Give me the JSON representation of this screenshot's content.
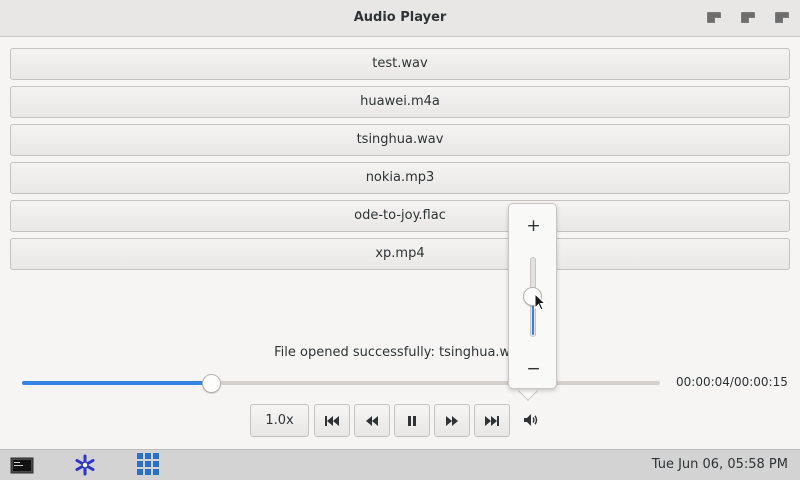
{
  "window": {
    "title": "Audio Player",
    "controls": [
      "minimize-icon",
      "maximize-icon",
      "close-icon"
    ]
  },
  "playlist": [
    {
      "name": "test.wav"
    },
    {
      "name": "huawei.m4a"
    },
    {
      "name": "tsinghua.wav"
    },
    {
      "name": "nokia.mp3"
    },
    {
      "name": "ode-to-joy.flac"
    },
    {
      "name": "xp.mp4"
    }
  ],
  "status_text": "File opened successfully: tsinghua.wav",
  "seek": {
    "progress_fraction": 0.296,
    "time": "00:00:04/00:00:15"
  },
  "controls": {
    "speed_label": "1.0x",
    "buttons": [
      "skip-previous-icon",
      "rewind-icon",
      "pause-icon",
      "fast-forward-icon",
      "skip-next-icon"
    ],
    "volume_icon": "volume-icon"
  },
  "volume_popover": {
    "plus": "+",
    "minus": "−",
    "level_fraction": 0.5
  },
  "taskbar": {
    "icons": [
      "terminal-icon",
      "asterisk-app-icon",
      "app-grid-icon"
    ],
    "clock": "Tue Jun 06, 05:58 PM"
  },
  "colors": {
    "accent": "#3584e4",
    "window_bg": "#f6f5f4",
    "taskbar_bg": "#d3d3d3",
    "asterisk_icon": "#2b36c9",
    "grid_icon": "#2a70c9"
  }
}
